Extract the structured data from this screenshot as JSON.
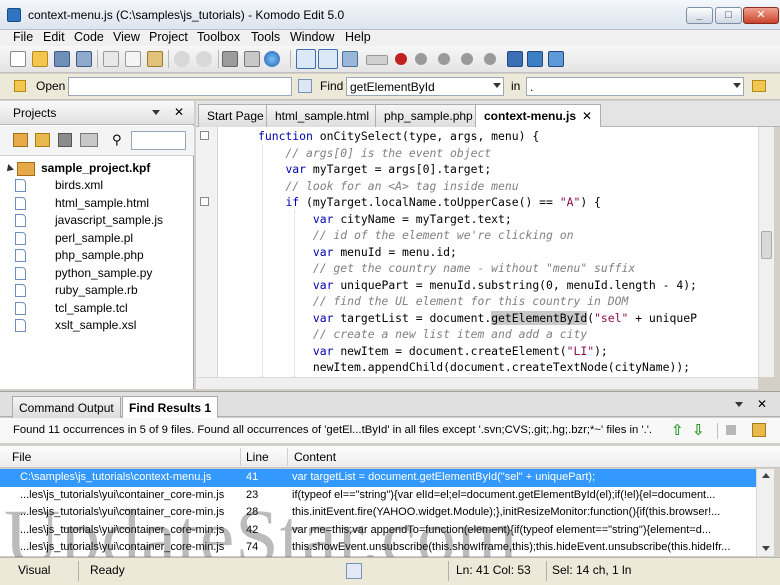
{
  "window": {
    "title": "context-menu.js (C:\\samples\\js_tutorials) - Komodo Edit 5.0",
    "minimize": "_",
    "maximize": "□",
    "close": "✕"
  },
  "menu": [
    "File",
    "Edit",
    "Code",
    "View",
    "Project",
    "Toolbox",
    "Tools",
    "Window",
    "Help"
  ],
  "findbar": {
    "open_label": "Open",
    "open_value": "",
    "find_label": "Find",
    "find_value": "getElementById",
    "in_label": "in",
    "in_value": "."
  },
  "projects": {
    "title": "Projects",
    "close": "✕",
    "project_name": "sample_project.kpf",
    "files": [
      "birds.xml",
      "html_sample.html",
      "javascript_sample.js",
      "perl_sample.pl",
      "php_sample.php",
      "python_sample.py",
      "ruby_sample.rb",
      "tcl_sample.tcl",
      "xslt_sample.xsl"
    ]
  },
  "editor": {
    "tabs": [
      "Start Page",
      "html_sample.html",
      "php_sample.php",
      "context-menu.js"
    ],
    "active_tab_close": "✕",
    "lines": [
      [
        {
          "t": "function ",
          "c": "kw"
        },
        {
          "t": "onCitySelect(type, args, menu) {",
          "c": ""
        }
      ],
      [
        {
          "t": "    // args[0] is the event object",
          "c": "cm"
        }
      ],
      [
        {
          "t": "    ",
          "c": ""
        },
        {
          "t": "var ",
          "c": "kw"
        },
        {
          "t": "myTarget = args[0].target;",
          "c": ""
        }
      ],
      [
        {
          "t": "    // look for an <A> tag inside menu",
          "c": "cm"
        }
      ],
      [
        {
          "t": "    ",
          "c": ""
        },
        {
          "t": "if ",
          "c": "kw"
        },
        {
          "t": "(myTarget.localName.toUpperCase() == ",
          "c": ""
        },
        {
          "t": "\"A\"",
          "c": "st"
        },
        {
          "t": ") {",
          "c": ""
        }
      ],
      [
        {
          "t": "        ",
          "c": ""
        },
        {
          "t": "var ",
          "c": "kw"
        },
        {
          "t": "cityName = myTarget.text;",
          "c": ""
        }
      ],
      [
        {
          "t": "        // id of the element we're clicking on",
          "c": "cm"
        }
      ],
      [
        {
          "t": "        ",
          "c": ""
        },
        {
          "t": "var ",
          "c": "kw"
        },
        {
          "t": "menuId = menu.id;",
          "c": ""
        }
      ],
      [
        {
          "t": "        // get the country name - without \"menu\" suffix",
          "c": "cm"
        }
      ],
      [
        {
          "t": "        ",
          "c": ""
        },
        {
          "t": "var ",
          "c": "kw"
        },
        {
          "t": "uniquePart = menuId.substring(0, menuId.length - 4);",
          "c": ""
        }
      ],
      [
        {
          "t": "        // find the UL element for this country in DOM",
          "c": "cm"
        }
      ],
      [
        {
          "t": "        ",
          "c": ""
        },
        {
          "t": "var ",
          "c": "kw"
        },
        {
          "t": "targetList = document.",
          "c": ""
        },
        {
          "t": "getElementById",
          "c": "hl"
        },
        {
          "t": "(",
          "c": ""
        },
        {
          "t": "\"sel\"",
          "c": "st"
        },
        {
          "t": " + uniqueP",
          "c": ""
        }
      ],
      [
        {
          "t": "        // create a new list item and add a city",
          "c": "cm"
        }
      ],
      [
        {
          "t": "        ",
          "c": ""
        },
        {
          "t": "var ",
          "c": "kw"
        },
        {
          "t": "newItem = document.createElement(",
          "c": ""
        },
        {
          "t": "\"LI\"",
          "c": "st"
        },
        {
          "t": ");",
          "c": ""
        }
      ],
      [
        {
          "t": "        newItem.appendChild(document.createTextNode(cityName));",
          "c": ""
        }
      ]
    ]
  },
  "bottom": {
    "tabs": [
      "Command Output",
      "Find Results 1"
    ],
    "summary": "Found 11 occurrences in 5 of 9 files. Found all occurrences of 'getEl...tById' in all files except '.svn;CVS;.git;.hg;.bzr;*~' files in '.'.",
    "columns": {
      "file": "File",
      "line": "Line",
      "content": "Content"
    },
    "results": [
      {
        "file": "C:\\samples\\js_tutorials\\context-menu.js",
        "line": "41",
        "content": "            var targetList = document.getElementById(\"sel\" + uniquePart);"
      },
      {
        "file": "...les\\js_tutorials\\yui\\container_core-min.js",
        "line": "23",
        "content": "if(typeof el==\"string\"){var elId=el;el=document.getElementById(el);if(!el){el=document..."
      },
      {
        "file": "...les\\js_tutorials\\yui\\container_core-min.js",
        "line": "28",
        "content": "this.initEvent.fire(YAHOO.widget.Module);},initResizeMonitor:function(){if(this.browser!..."
      },
      {
        "file": "...les\\js_tutorials\\yui\\container_core-min.js",
        "line": "42",
        "content": "var me=this;var appendTo=function(element){if(typeof element==\"string\"){element=d..."
      },
      {
        "file": "...les\\js_tutorials\\yui\\container_core-min.js",
        "line": "74",
        "content": "this.showEvent.unsubscribe(this.showIframe,this);this.hideEvent.unsubscribe(this.hideIfr..."
      }
    ]
  },
  "status": {
    "mode": "Visual",
    "state": "Ready",
    "position": "Ln: 41 Col: 53",
    "selection": "Sel: 14 ch, 1 ln"
  },
  "watermark": "UpdateStar.com",
  "colors": {
    "accent": "#3399ff",
    "keyword": "#0000b0",
    "comment": "#808080",
    "string": "#8b0a50"
  }
}
